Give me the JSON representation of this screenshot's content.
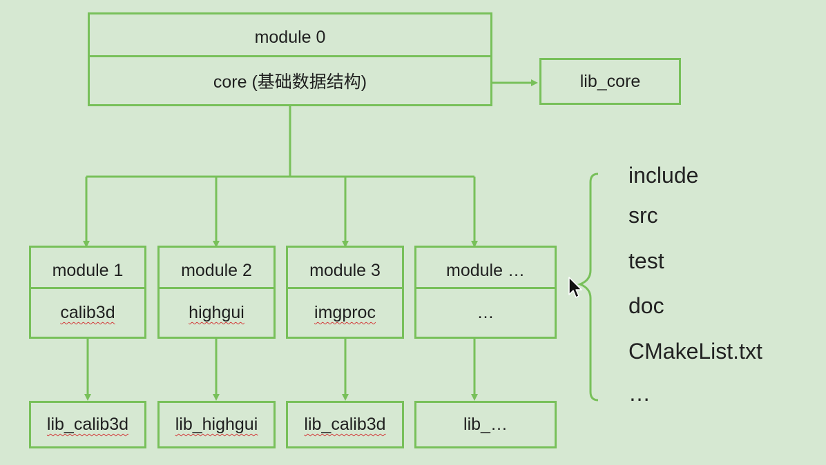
{
  "core_module": {
    "name": "module 0",
    "label": "core (基础数据结构)",
    "library": "lib_core"
  },
  "modules": [
    {
      "name": "module 1",
      "label": "calib3d",
      "library": "lib_calib3d"
    },
    {
      "name": "module 2",
      "label": "highgui",
      "library": "lib_highgui"
    },
    {
      "name": "module 3",
      "label": "imgproc",
      "library": "lib_calib3d"
    },
    {
      "name": "module …",
      "label": "…",
      "library": "lib_…"
    }
  ],
  "module_contents": [
    "include",
    "src",
    "test",
    "doc",
    "CMakeList.txt",
    "…"
  ],
  "colors": {
    "line": "#78c05a",
    "background": "#d6e8d2",
    "spell_underline": "#d23a3a"
  },
  "icons": [
    "mouse-cursor-icon"
  ]
}
